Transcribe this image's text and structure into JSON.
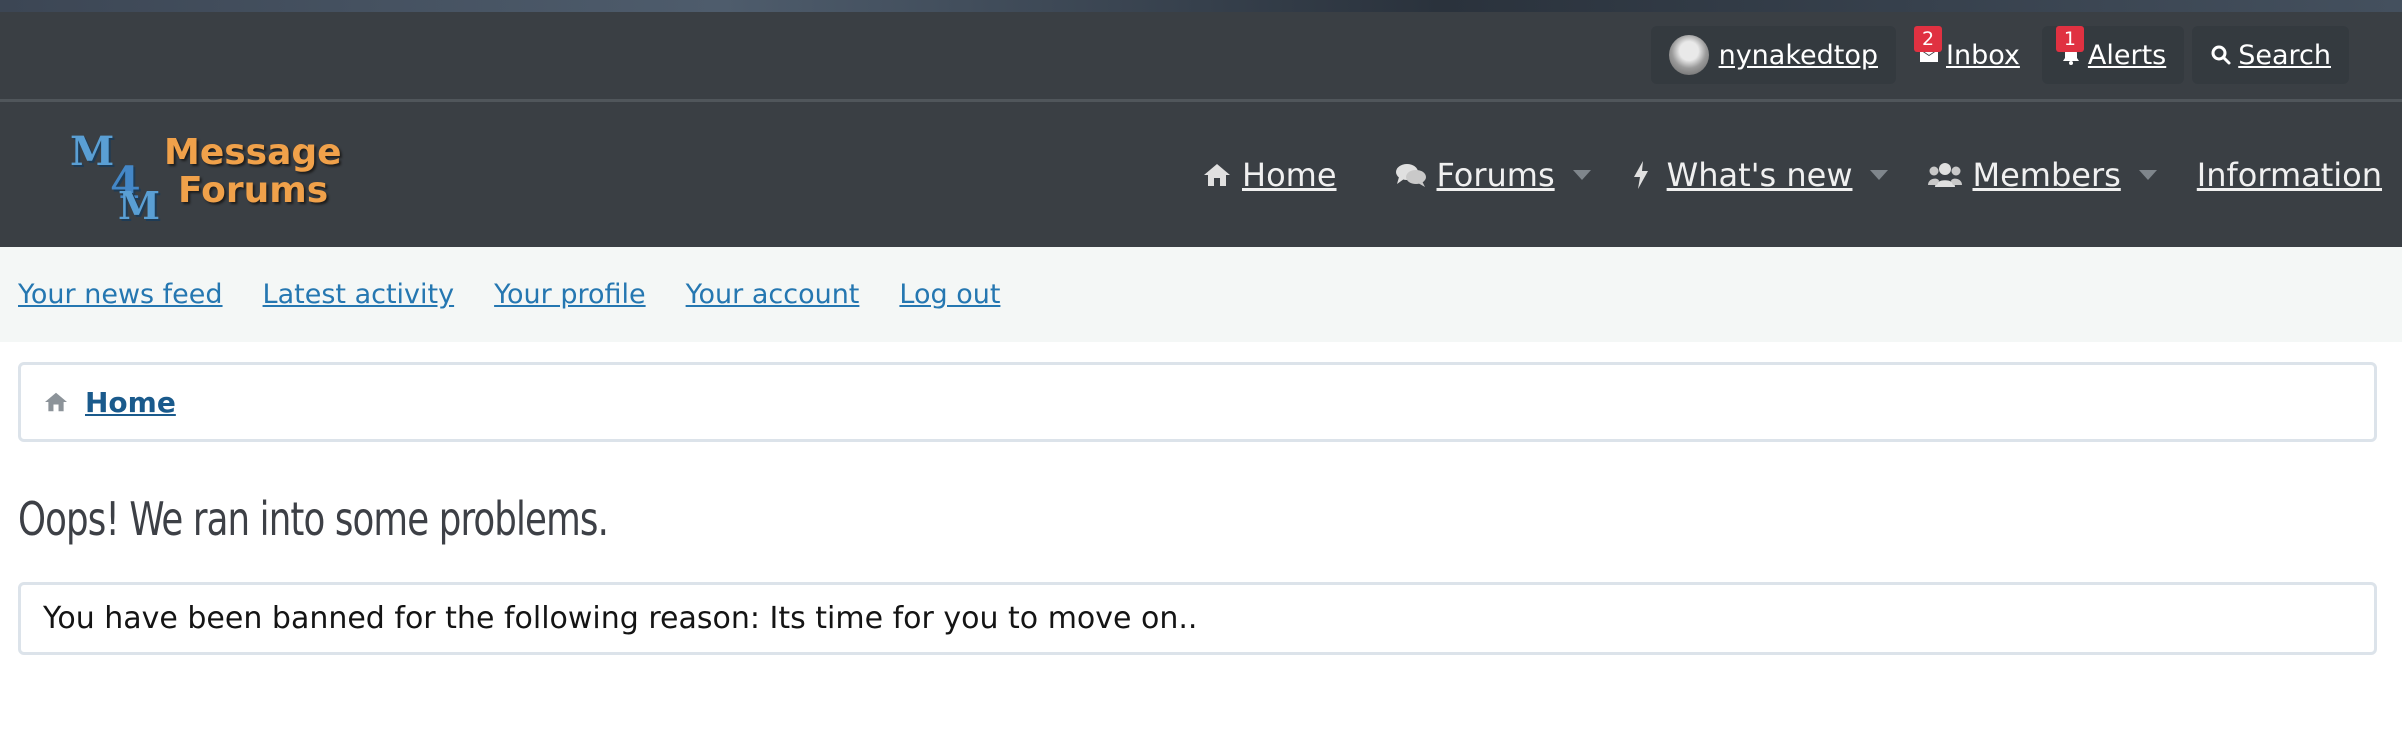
{
  "account": {
    "username": "nynakedtop",
    "inbox_label": "Inbox",
    "inbox_count": "2",
    "alerts_label": "Alerts",
    "alerts_count": "1",
    "search_label": "Search"
  },
  "logo": {
    "mark_letters": [
      "M",
      "4",
      "M"
    ],
    "line1": "Message",
    "line2": "Forums"
  },
  "nav": {
    "home": "Home",
    "forums": "Forums",
    "whats_new": "What's new",
    "members": "Members",
    "information": "Information"
  },
  "subnav": {
    "news_feed": "Your news feed",
    "latest_activity": "Latest activity",
    "profile": "Your profile",
    "account": "Your account",
    "log_out": "Log out"
  },
  "breadcrumb": {
    "home": "Home"
  },
  "error": {
    "title": "Oops! We ran into some problems.",
    "message": "You have been banned for the following reason: Its time for you to move on.."
  },
  "colors": {
    "header_bg": "#3a3f44",
    "subnav_bg": "#f4f7f6",
    "link": "#2577b1",
    "badge": "#e03141",
    "logo_orange": "#f0a14a",
    "logo_blue": "#5a9fd4"
  },
  "icons": {
    "inbox": "envelope-icon",
    "alerts": "bell-icon",
    "search": "search-icon",
    "home": "home-icon",
    "forums": "comments-icon",
    "whats_new": "bolt-icon",
    "members": "users-icon"
  }
}
